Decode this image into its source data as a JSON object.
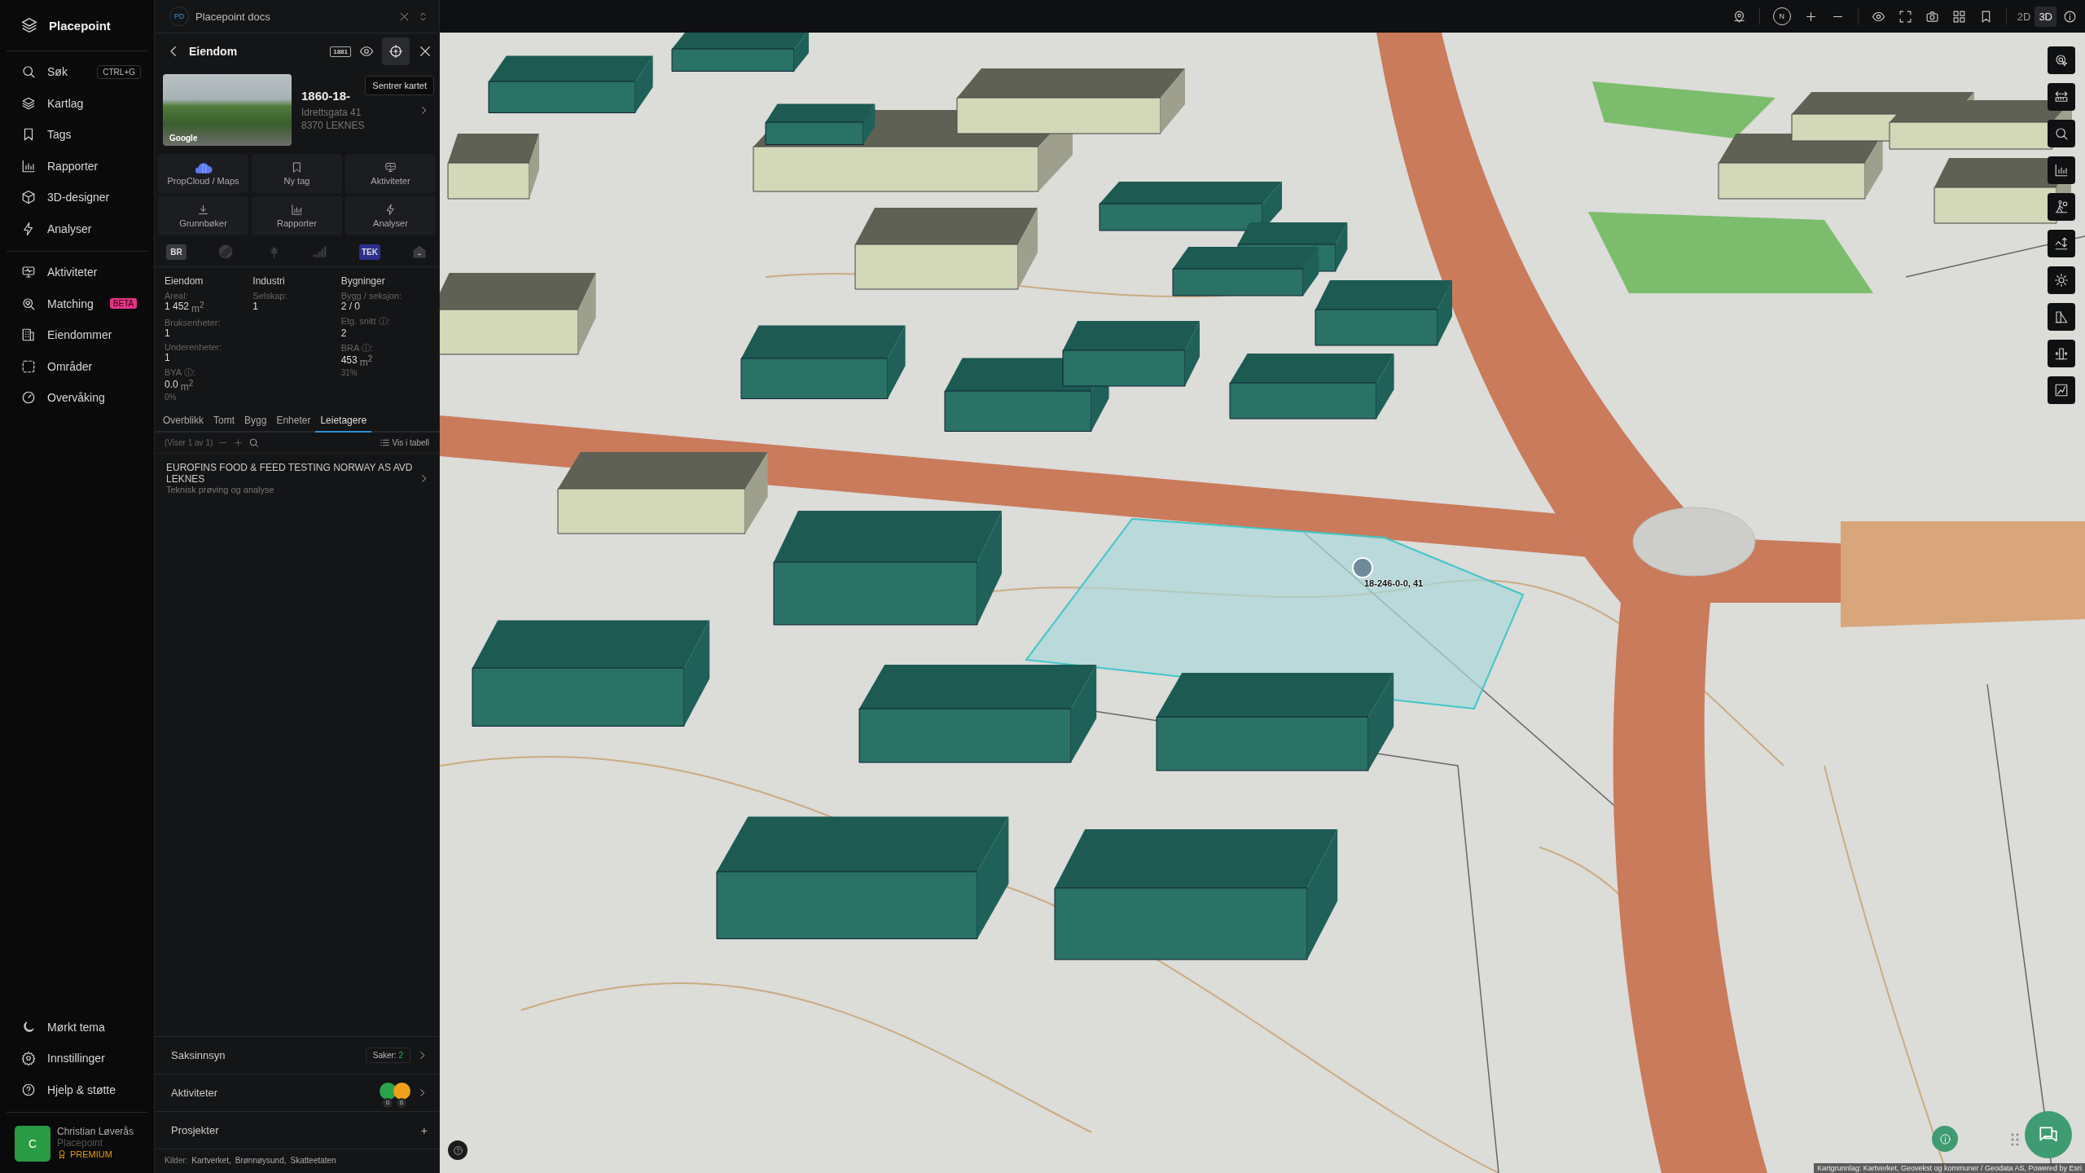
{
  "sidebar": {
    "brand": "Placepoint",
    "nav": [
      {
        "label": "Søk",
        "shortcut": "CTRL+G",
        "selected": false
      },
      {
        "label": "Kartlag",
        "selected": false
      },
      {
        "label": "Tags",
        "selected": false
      },
      {
        "label": "Rapporter",
        "selected": false
      },
      {
        "label": "3D-designer",
        "selected": false
      },
      {
        "label": "Analyser",
        "selected": false
      }
    ],
    "nav2": [
      {
        "label": "Aktiviteter",
        "selected": false
      },
      {
        "label": "Matching",
        "badge": "BETA",
        "selected": false
      },
      {
        "label": "Eiendommer",
        "selected": false
      },
      {
        "label": "Områder",
        "selected": false
      },
      {
        "label": "Overvåking",
        "selected": false
      }
    ],
    "footer": [
      {
        "label": "Mørkt tema"
      },
      {
        "label": "Innstillinger"
      },
      {
        "label": "Hjelp & støtte"
      }
    ],
    "user": {
      "initial": "C",
      "name": "Christian Løverås",
      "org": "Placepoint",
      "plan": "PREMIUM"
    }
  },
  "workspace": {
    "initials": "PD",
    "name": "Placepoint docs"
  },
  "detail": {
    "title": "Eiendom",
    "directory_badge": "1881",
    "tooltip": "Sentrer kartet",
    "photo_credit": "Google",
    "property_id": "1860-18-",
    "address": "Idrettsgata 41",
    "postal": "8370 LEKNES",
    "actions": [
      "PropCloud / Maps",
      "Ny tag",
      "Aktiviteter",
      "Grunnbøker",
      "Rapporter",
      "Analyser"
    ],
    "registers": [
      {
        "kind": "badge",
        "label": "BR",
        "color": "#3a3b3e"
      },
      {
        "kind": "icon"
      },
      {
        "kind": "icon"
      },
      {
        "kind": "icon"
      },
      {
        "kind": "badge",
        "label": "TEK",
        "color": "#2d2f8e"
      },
      {
        "kind": "icon"
      }
    ],
    "stats": [
      {
        "heading": "Eiendom",
        "items": [
          {
            "label": "Areal:",
            "value": "1 452",
            "unit": "m$^{2}$"
          },
          {
            "label": "Bruksenheter:",
            "value": "1"
          },
          {
            "label": "Underenheter:",
            "value": "1"
          },
          {
            "label": "BYA ⓘ:",
            "value": "0.0",
            "unit": "m$^{2}$",
            "share": "0%"
          }
        ]
      },
      {
        "heading": "Industri",
        "items": [
          {
            "label": "Selskap:",
            "value": "1"
          }
        ]
      },
      {
        "heading": "Bygninger",
        "items": [
          {
            "label": "Bygg / seksjon:",
            "value": "2 / 0"
          },
          {
            "label": "Etg. snitt ⓘ:",
            "value": "2"
          },
          {
            "label": "BRA ⓘ:",
            "value": "453",
            "unit": "m$^{2}$",
            "share": "31%"
          }
        ]
      }
    ],
    "tabs": [
      {
        "label": "Overblikk",
        "selected": false
      },
      {
        "label": "Tomt",
        "selected": false
      },
      {
        "label": "Bygg",
        "selected": false
      },
      {
        "label": "Enheter",
        "selected": false
      },
      {
        "label": "Leietagere",
        "selected": true
      }
    ],
    "list_count": "(Viser 1 av 1)",
    "table_link": "Vis i tabell",
    "tenants": [
      {
        "name": "EUROFINS FOOD & FEED TESTING NORWAY AS AVD LEKNES",
        "industry": "Teknisk prøving og analyse"
      }
    ],
    "sections": [
      {
        "kind": "cases",
        "label": "Saksinnsyn",
        "badge_label": "Saker:",
        "badge_value": "2"
      },
      {
        "kind": "activities",
        "label": "Aktiviteter",
        "counts": [
          "0",
          "0"
        ]
      },
      {
        "kind": "add",
        "label": "Prosjekter",
        "action": "+"
      }
    ],
    "sources_label": "Kilder:",
    "sources": [
      "Kartverket,",
      "Brønnøysund,",
      "Skatteetaten"
    ]
  },
  "map_toolbar": {
    "compass": "N",
    "modes": [
      {
        "label": "2D",
        "selected": false
      },
      {
        "label": "3D",
        "selected": true
      }
    ]
  },
  "map": {
    "marker_label": "18-246-0-0, 41",
    "attribution": "Kartgrunnlag: Kartverket, Geovekst og kommuner / Geodata AS, Powered by Esri"
  }
}
